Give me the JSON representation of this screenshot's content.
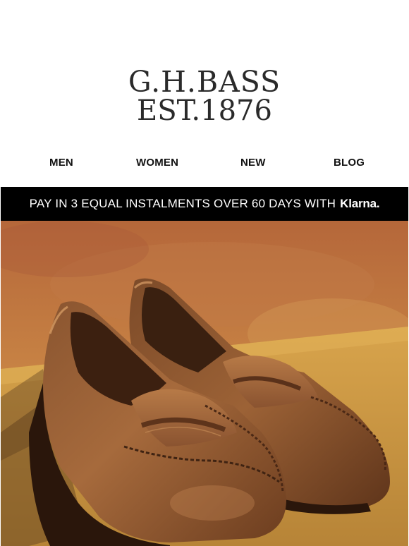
{
  "brand": {
    "line1": "G.H.BASS",
    "line2": "EST.1876"
  },
  "nav": {
    "items": [
      "MEN",
      "WOMEN",
      "NEW",
      "BLOG"
    ]
  },
  "banner": {
    "text": "PAY IN 3 EQUAL INSTALMENTS OVER 60 DAYS WITH",
    "klarna": "Klarna."
  },
  "hero": {
    "icon": "penny-loafers-photo"
  }
}
